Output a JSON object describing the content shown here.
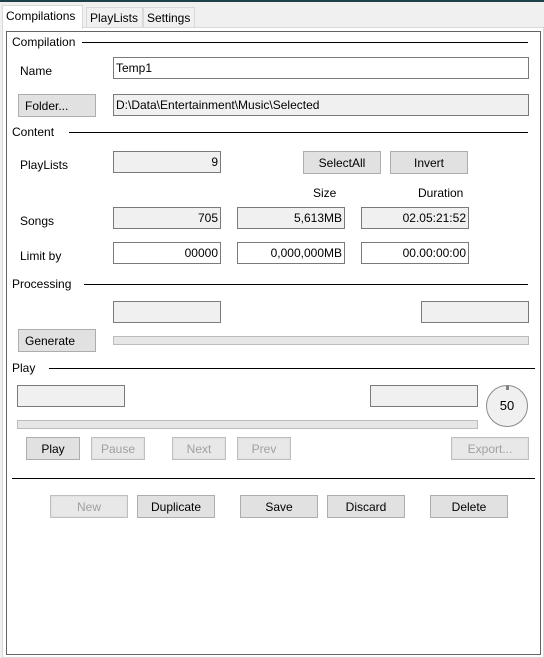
{
  "tabs": [
    {
      "label": "Compilations",
      "active": true
    },
    {
      "label": "PlayLists",
      "active": false
    },
    {
      "label": "Settings",
      "active": false
    }
  ],
  "compilation": {
    "section_label": "Compilation",
    "name_label": "Name",
    "name_value": "Temp1",
    "folder_button": "Folder...",
    "folder_value": "D:\\Data\\Entertainment\\Music\\Selected"
  },
  "content": {
    "section_label": "Content",
    "playlists_label": "PlayLists",
    "playlists_value": "9",
    "select_all_button": "SelectAll",
    "invert_button": "Invert",
    "size_header": "Size",
    "duration_header": "Duration",
    "songs_label": "Songs",
    "songs_count": "705",
    "songs_size": "5,613MB",
    "songs_duration": "02.05:21:52",
    "limit_label": "Limit by",
    "limit_count": "00000",
    "limit_size": "0,000,000MB",
    "limit_duration": "00.00:00:00"
  },
  "processing": {
    "section_label": "Processing",
    "status_left": "",
    "status_right": "",
    "generate_button": "Generate",
    "progress": 0
  },
  "play": {
    "section_label": "Play",
    "status_left": "",
    "status_right": "",
    "volume": "50",
    "progress": 0,
    "buttons": {
      "play": "Play",
      "pause": "Pause",
      "next": "Next",
      "prev": "Prev",
      "export": "Export..."
    }
  },
  "actions": {
    "new": "New",
    "duplicate": "Duplicate",
    "save": "Save",
    "discard": "Discard",
    "delete": "Delete"
  }
}
